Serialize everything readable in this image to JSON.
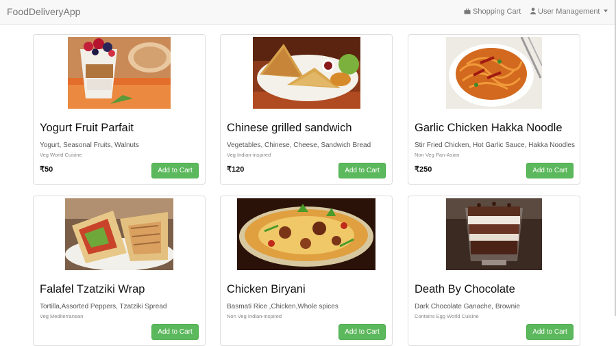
{
  "navbar": {
    "brand": "FoodDeliveryApp",
    "cart_label": "Shopping Cart",
    "user_label": "User Management",
    "cart_icon": "shopping-basket-icon",
    "user_icon": "user-icon"
  },
  "colors": {
    "button": "#5cb85c",
    "navbar_bg": "#f8f8f8"
  },
  "items": [
    {
      "title": "Yogurt Fruit Parfait",
      "ingredients": "Yogurt, Seasonal Fruits, Walnuts",
      "meta": "Veg World Cuisine",
      "price": "₹50",
      "button": "Add to Cart"
    },
    {
      "title": "Chinese grilled sandwich",
      "ingredients": "Vegetables, Chinese, Cheese, Sandwich Bread",
      "meta": "Veg Indian-inspired",
      "price": "₹120",
      "button": "Add to Cart"
    },
    {
      "title": "Garlic Chicken Hakka Noodle",
      "ingredients": "Stir Fried Chicken, Hot Garlic Sauce, Hakka Noodles",
      "meta": "Non Veg Pan-Asian",
      "price": "₹250",
      "button": "Add to Cart"
    },
    {
      "title": "Falafel Tzatziki Wrap",
      "ingredients": "Tortilla,Assorted Peppers, Tzatziki Spread",
      "meta": "Veg Mediterranean",
      "price": "",
      "button": "Add to Cart"
    },
    {
      "title": "Chicken Biryani",
      "ingredients": "Basmati Rice ,Chicken,Whole spices",
      "meta": "Non Veg Indian-inspired",
      "price": "",
      "button": "Add to Cart"
    },
    {
      "title": "Death By Chocolate",
      "ingredients": "Dark Chocolate Ganache, Brownie",
      "meta": "Contains Egg World Cuisine",
      "price": "",
      "button": "Add to Cart"
    }
  ]
}
